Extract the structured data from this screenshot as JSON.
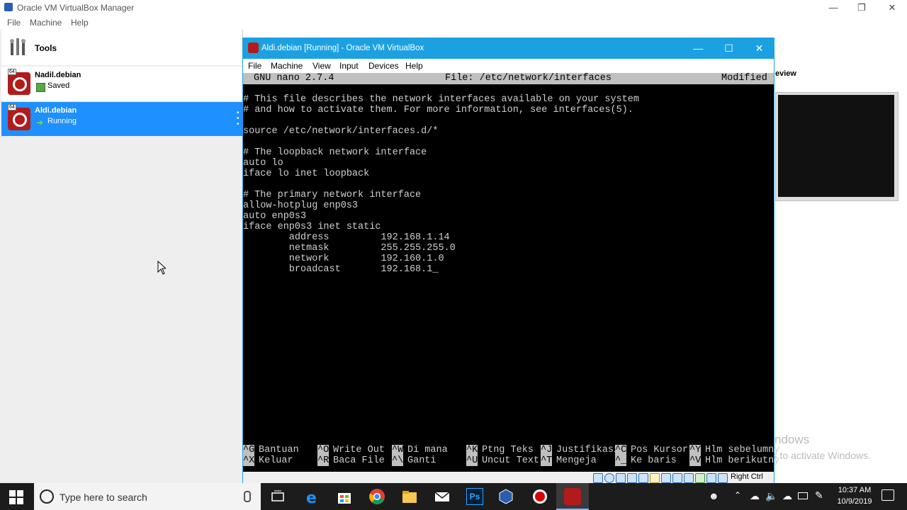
{
  "manager": {
    "title": "Oracle VM VirtualBox Manager",
    "menu": [
      "File",
      "Machine",
      "Help"
    ],
    "tools_label": "Tools",
    "vms": [
      {
        "name": "Nadil.debian",
        "status": "Saved",
        "badge": "64"
      },
      {
        "name": "Aldi.debian",
        "status": "Running",
        "badge": "64"
      }
    ],
    "preview_label": "eview"
  },
  "vm_window": {
    "title": "Aldi.debian [Running] - Oracle VM VirtualBox",
    "menu": [
      "File",
      "Machine",
      "View",
      "Input",
      "Devices",
      "Help"
    ],
    "host_key": "Right Ctrl"
  },
  "nano": {
    "version": "GNU nano 2.7.4",
    "file": "File: /etc/network/interfaces",
    "state": "Modified",
    "lines": [
      "",
      "# This file describes the network interfaces available on your system",
      "# and how to activate them. For more information, see interfaces(5).",
      "",
      "source /etc/network/interfaces.d/*",
      "",
      "# The loopback network interface",
      "auto lo",
      "iface lo inet loopback",
      "",
      "# The primary network interface",
      "allow-hotplug enp0s3",
      "auto enp0s3",
      "iface enp0s3 inet static",
      "        address         192.168.1.14",
      "        netmask         255.255.255.0",
      "        network         192.160.1.0",
      "        broadcast       192.168.1_"
    ],
    "shortcuts_row1": [
      {
        "key": "^G",
        "label": "Bantuan"
      },
      {
        "key": "^O",
        "label": "Write Out"
      },
      {
        "key": "^W",
        "label": "Di mana"
      },
      {
        "key": "^K",
        "label": "Ptng Teks"
      },
      {
        "key": "^J",
        "label": "Justifikasi"
      },
      {
        "key": "^C",
        "label": "Pos Kursor"
      },
      {
        "key": "^Y",
        "label": "Hlm sebelumny"
      }
    ],
    "shortcuts_row2": [
      {
        "key": "^X",
        "label": "Keluar"
      },
      {
        "key": "^R",
        "label": "Baca File"
      },
      {
        "key": "^\\",
        "label": "Ganti"
      },
      {
        "key": "^U",
        "label": "Uncut Text"
      },
      {
        "key": "^T",
        "label": "Mengeja"
      },
      {
        "key": "^_",
        "label": "Ke baris"
      },
      {
        "key": "^V",
        "label": "Hlm berikutny"
      }
    ]
  },
  "watermark": {
    "line1": "Activate Windows",
    "line2": "Go to Settings to activate Windows."
  },
  "taskbar": {
    "search_placeholder": "Type here to search",
    "time": "10:37 AM",
    "date": "10/9/2019",
    "apps": [
      "task-view-icon",
      "edge-icon",
      "store-icon",
      "chrome-icon",
      "file-explorer-icon",
      "mail-icon",
      "photoshop-icon",
      "virtualbox-icon",
      "recorder-icon",
      "debian-vm-icon"
    ],
    "photoshop_label": "Ps"
  },
  "colors": {
    "vm_accent": "#1ba1e2",
    "selection": "#1e90ff",
    "debian_red": "#b31b1b"
  }
}
